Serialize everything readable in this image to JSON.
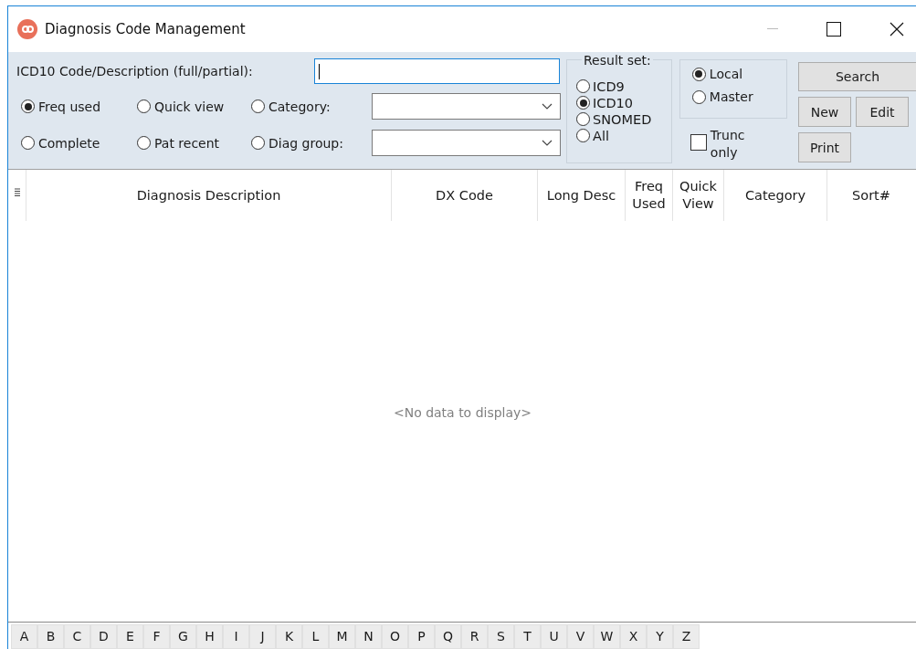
{
  "window": {
    "title": "Diagnosis Code Management"
  },
  "search": {
    "label": "ICD10 Code/Description (full/partial):"
  },
  "filters": [
    {
      "label": "Freq used",
      "selected": true,
      "kind": "radio"
    },
    {
      "label": "Quick view",
      "selected": false,
      "kind": "radio"
    },
    {
      "label": "Category:",
      "selected": false,
      "kind": "combo"
    },
    {
      "label": "Complete",
      "selected": false,
      "kind": "radio"
    },
    {
      "label": "Pat recent",
      "selected": false,
      "kind": "radio"
    },
    {
      "label": "Diag group:",
      "selected": false,
      "kind": "combo"
    }
  ],
  "result_set": {
    "title": "Result set:",
    "options": [
      {
        "label": "ICD9",
        "selected": false
      },
      {
        "label": "ICD10",
        "selected": true
      },
      {
        "label": "SNOMED",
        "selected": false
      },
      {
        "label": "All",
        "selected": false
      }
    ]
  },
  "source": [
    {
      "label": "Local",
      "selected": true
    },
    {
      "label": "Master",
      "selected": false
    }
  ],
  "trunc_only": {
    "label": "Trunc only",
    "checked": false
  },
  "buttons": [
    "Search",
    "New",
    "Edit",
    "Print"
  ],
  "table": {
    "columns": [
      "Diagnosis Description",
      "DX Code",
      "Long Desc",
      "Freq Used",
      "Quick View",
      "Category",
      "Sort#"
    ],
    "empty_message": "<No data to display>"
  },
  "letters": [
    "A",
    "B",
    "C",
    "D",
    "E",
    "F",
    "G",
    "H",
    "I",
    "J",
    "K",
    "L",
    "M",
    "N",
    "O",
    "P",
    "Q",
    "R",
    "S",
    "T",
    "U",
    "V",
    "W",
    "X",
    "Y",
    "Z"
  ]
}
